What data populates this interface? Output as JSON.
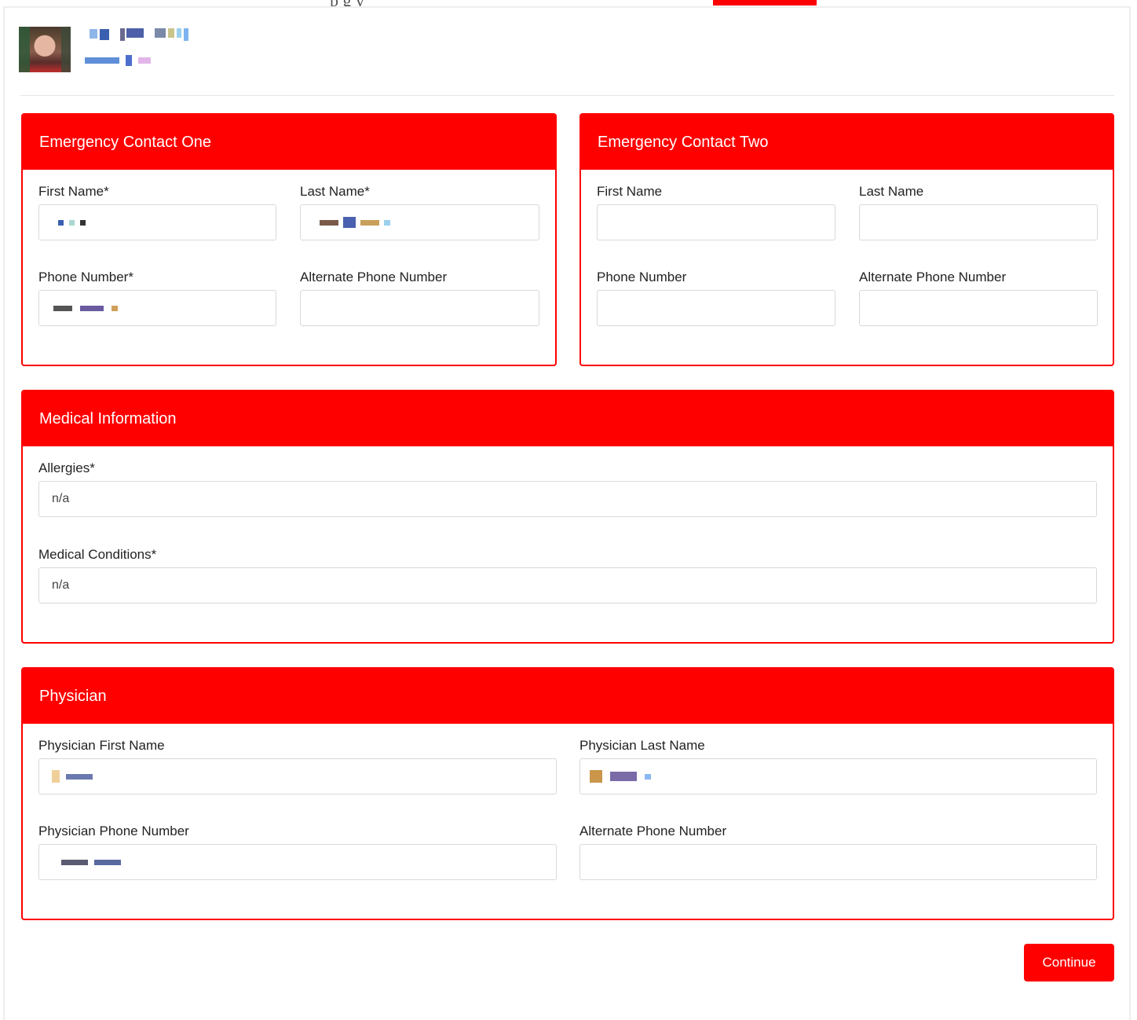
{
  "theme": {
    "accent": "#ff0000",
    "border": "#d9d9d9"
  },
  "header": {
    "top_fragment": "p            g   y"
  },
  "emergency_one": {
    "title": "Emergency Contact One",
    "first_name_label": "First Name*",
    "last_name_label": "Last Name*",
    "phone_label": "Phone Number*",
    "alt_phone_label": "Alternate Phone Number",
    "alt_phone_value": ""
  },
  "emergency_two": {
    "title": "Emergency Contact Two",
    "first_name_label": "First Name",
    "last_name_label": "Last Name",
    "phone_label": "Phone Number",
    "alt_phone_label": "Alternate Phone Number",
    "first_name_value": "",
    "last_name_value": "",
    "phone_value": "",
    "alt_phone_value": ""
  },
  "medical": {
    "title": "Medical Information",
    "allergies_label": "Allergies*",
    "allergies_value": "n/a",
    "conditions_label": "Medical Conditions*",
    "conditions_value": "n/a"
  },
  "physician": {
    "title": "Physician",
    "first_name_label": "Physician First Name",
    "last_name_label": "Physician Last Name",
    "phone_label": "Physician Phone Number",
    "alt_phone_label": "Alternate Phone Number",
    "alt_phone_value": ""
  },
  "actions": {
    "continue_label": "Continue"
  }
}
